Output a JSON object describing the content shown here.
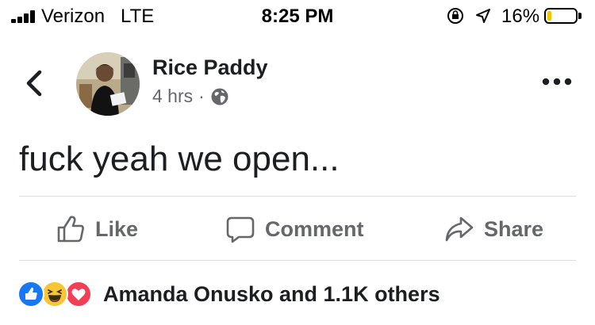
{
  "status_bar": {
    "carrier": "Verizon",
    "network": "LTE",
    "time": "8:25 PM",
    "battery_percent": "16%",
    "battery_level": 0.16,
    "battery_color": "#f5c400"
  },
  "post": {
    "author": "Rice Paddy",
    "time_ago": "4 hrs",
    "separator": "·",
    "privacy_icon": "globe-icon",
    "text": "fuck yeah we open..."
  },
  "actions": {
    "like_label": "Like",
    "comment_label": "Comment",
    "share_label": "Share"
  },
  "reactions": {
    "icons": [
      "like-reaction-icon",
      "haha-reaction-icon",
      "love-reaction-icon"
    ],
    "summary": "Amanda Onusko and 1.1K others"
  },
  "colors": {
    "like_blue": "#1877f2",
    "love_red": "#f33e58",
    "haha_yellow": "#f7c635",
    "secondary_text": "#65676b"
  }
}
